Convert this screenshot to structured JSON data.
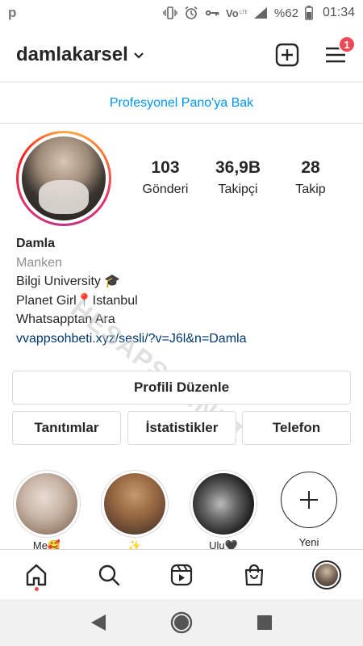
{
  "status_bar": {
    "left_icon": "p",
    "battery": "%62",
    "time": "01:34",
    "icons": [
      "vibrate-icon",
      "alarm-icon",
      "key-icon",
      "volte-icon",
      "signal-icon",
      "battery-icon"
    ]
  },
  "header": {
    "username": "damlakarsel",
    "notification_count": "1"
  },
  "pro_dashboard": "Profesyonel Pano'ya Bak",
  "stats": [
    {
      "num": "103",
      "label": "Gönderi"
    },
    {
      "num": "36,9B",
      "label": "Takipçi"
    },
    {
      "num": "28",
      "label": "Takip"
    }
  ],
  "bio": {
    "name": "Damla",
    "category": "Manken",
    "lines": [
      "Bilgi University 🎓",
      "Planet Girl📍Istanbul",
      "Whatsapptan Ara"
    ],
    "link": "vvappsohbeti.xyz/sesli/?v=J6l&n=Damla"
  },
  "watermark": "HESAPSAT.NET",
  "buttons": {
    "edit": "Profili Düzenle",
    "row": [
      "Tanıtımlar",
      "İstatistikler",
      "Telefon"
    ]
  },
  "highlights": [
    {
      "label": "Me🥰"
    },
    {
      "label": "✨"
    },
    {
      "label": "Ulu🖤"
    }
  ],
  "new_highlight": "Yeni",
  "colors": {
    "accent_blue": "#0095f6",
    "badge_red": "#ed4956",
    "link_dark": "#00376b",
    "border": "#dbdbdb"
  }
}
